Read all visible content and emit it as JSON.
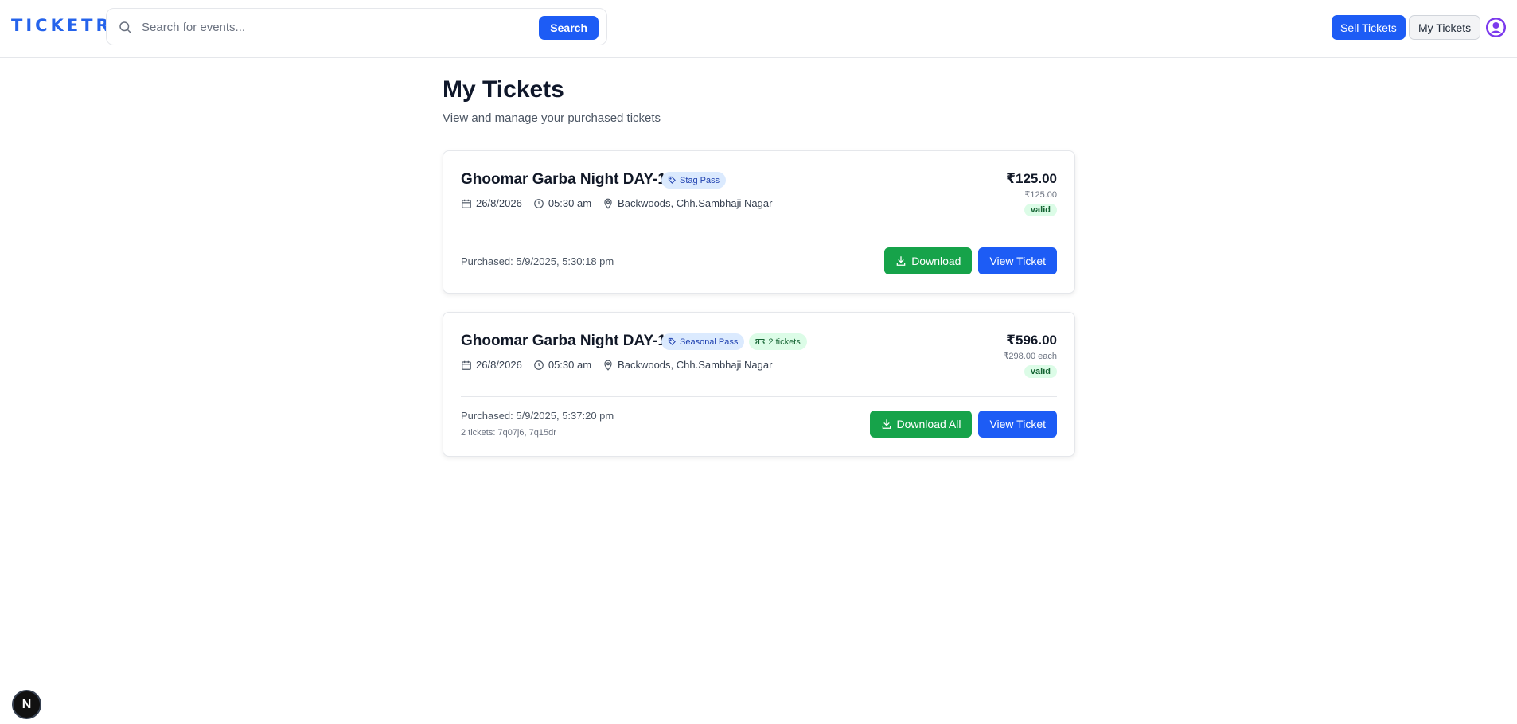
{
  "header": {
    "logo_text": "TICKETR",
    "search": {
      "placeholder": "Search for events...",
      "value": ""
    },
    "search_button": "Search",
    "sell_tickets_button": "Sell Tickets",
    "my_tickets_button": "My Tickets"
  },
  "page": {
    "title": "My Tickets",
    "subtitle": "View and manage your purchased tickets"
  },
  "tickets": [
    {
      "event_name": "Ghoomar Garba Night DAY-1",
      "pass_type": "Stag Pass",
      "date": "26/8/2026",
      "time": "05:30 am",
      "location": "Backwoods, Chh.Sambhaji Nagar",
      "total_price": "₹125.00",
      "price_detail": "₹125.00",
      "status": "valid",
      "purchased": "Purchased: 5/9/2025, 5:30:18 pm",
      "download_label": "Download",
      "view_label": "View Ticket"
    },
    {
      "event_name": "Ghoomar Garba Night DAY-1",
      "pass_type": "Seasonal Pass",
      "ticket_count": "2 tickets",
      "date": "26/8/2026",
      "time": "05:30 am",
      "location": "Backwoods, Chh.Sambhaji Nagar",
      "total_price": "₹596.00",
      "price_detail": "₹298.00 each",
      "status": "valid",
      "purchased": "Purchased: 5/9/2025, 5:37:20 pm",
      "ticket_ids": "2 tickets: 7q07j6, 7q15dr",
      "download_label": "Download All",
      "view_label": "View Ticket"
    }
  ],
  "dev_badge": "N",
  "colors": {
    "primary": "#1d5cf5",
    "success": "#16a34a",
    "valid_bg": "#dcfce7",
    "pass_badge_bg": "#dbeafe"
  },
  "icons": [
    "search-icon",
    "calendar-icon",
    "clock-icon",
    "map-pin-icon",
    "tag-icon",
    "ticket-icon",
    "download-icon",
    "avatar-icon"
  ]
}
